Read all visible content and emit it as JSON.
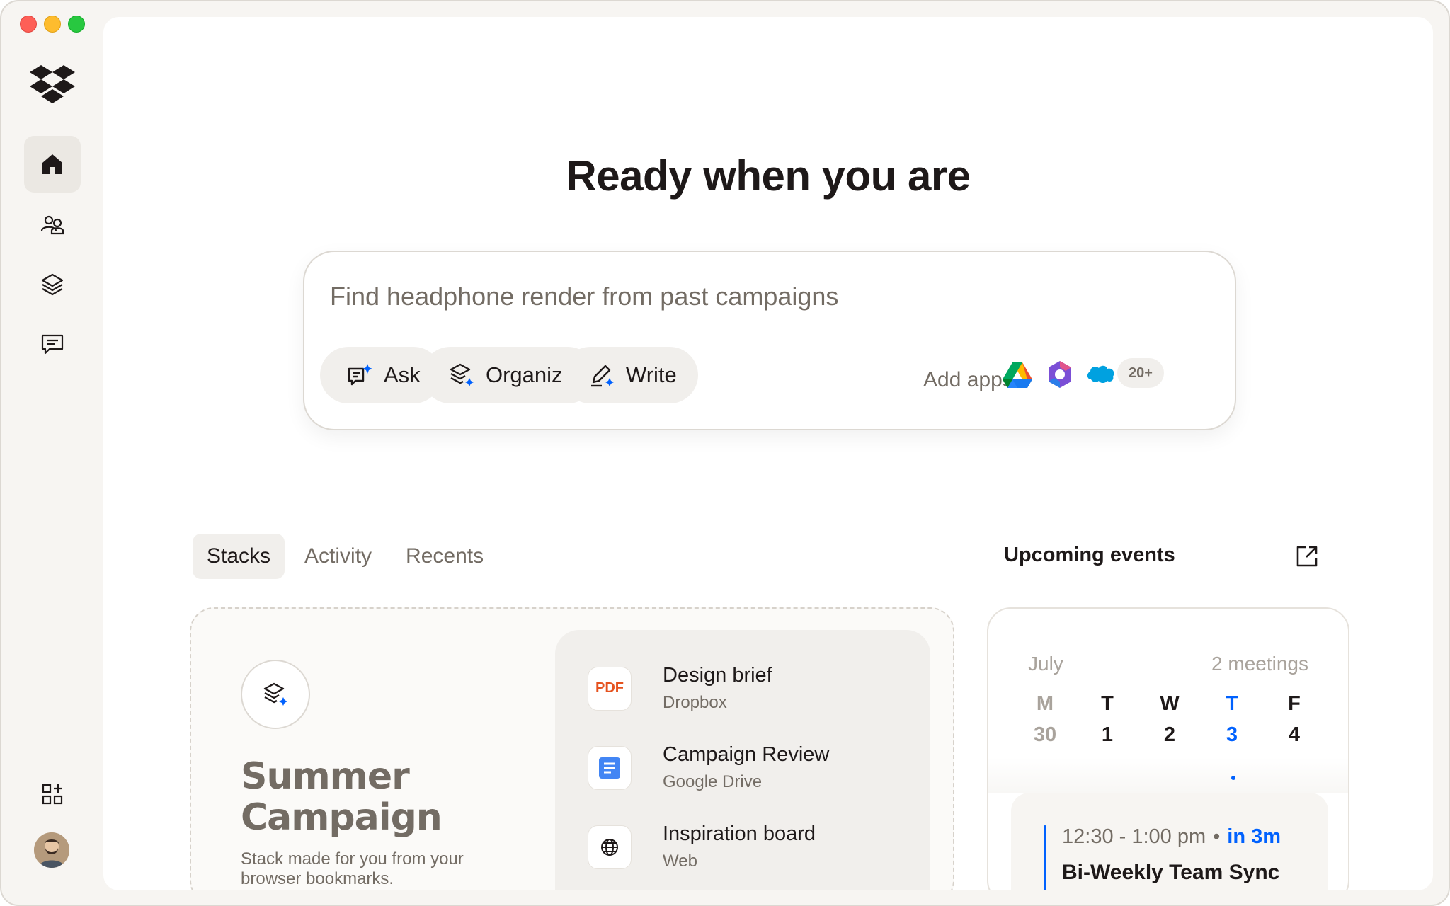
{
  "hero": {
    "title": "Ready when you are"
  },
  "search": {
    "placeholder": "Find headphone render from past campaigns",
    "actions": [
      {
        "label": "Ask",
        "icon": "ask-icon"
      },
      {
        "label": "Organize",
        "icon": "organize-icon"
      },
      {
        "label": "Write",
        "icon": "write-icon"
      }
    ],
    "add_apps_label": "Add apps",
    "apps": [
      "google-drive-icon",
      "microsoft-365-icon",
      "salesforce-icon"
    ],
    "more_apps": "20+"
  },
  "sidebar": {
    "items": [
      {
        "name": "home",
        "icon": "home-icon",
        "active": true
      },
      {
        "name": "people",
        "icon": "people-icon"
      },
      {
        "name": "stacks",
        "icon": "stacks-icon"
      },
      {
        "name": "chat",
        "icon": "chat-icon"
      }
    ],
    "bottom": [
      "add-apps-icon",
      "avatar"
    ]
  },
  "tabs": [
    {
      "label": "Stacks",
      "active": true
    },
    {
      "label": "Activity"
    },
    {
      "label": "Recents"
    }
  ],
  "stack": {
    "title": "Summer Campaign",
    "description": "Stack made for you from your browser bookmarks.",
    "files": [
      {
        "name": "Design brief",
        "source": "Dropbox",
        "icon_label": "PDF",
        "icon": "pdf-icon"
      },
      {
        "name": "Campaign Review",
        "source": "Google Drive",
        "icon": "google-docs-icon"
      },
      {
        "name": "Inspiration board",
        "source": "Web",
        "icon": "globe-icon"
      }
    ]
  },
  "events": {
    "title": "Upcoming events",
    "month": "July",
    "meetings": "2 meetings",
    "days": [
      {
        "dow": "M",
        "date": "30",
        "state": "past"
      },
      {
        "dow": "T",
        "date": "1"
      },
      {
        "dow": "W",
        "date": "2"
      },
      {
        "dow": "T",
        "date": "3",
        "state": "today"
      },
      {
        "dow": "F",
        "date": "4"
      }
    ],
    "next": {
      "time": "12:30 - 1:00 pm",
      "separator": "•",
      "countdown": "in 3m",
      "name": "Bi-Weekly Team Sync"
    }
  },
  "colors": {
    "accent": "#0061fe",
    "muted": "#736c64",
    "text": "#1e1919",
    "surface": "#f7f5f2"
  }
}
